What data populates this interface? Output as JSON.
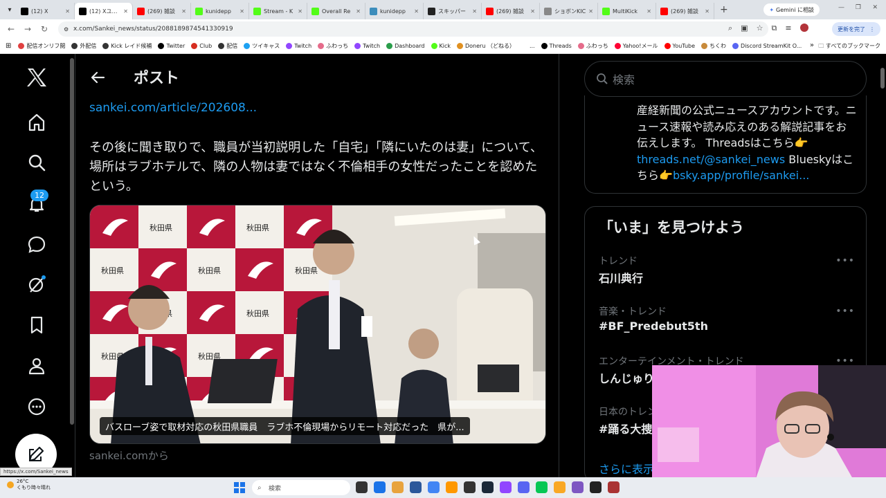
{
  "browser": {
    "tabs": [
      {
        "title": "(12) X",
        "icon": "x-icon",
        "color": "#000000"
      },
      {
        "title": "(12) Xユーザー",
        "icon": "x-icon",
        "color": "#000000",
        "active": true
      },
      {
        "title": "(269) 雑談",
        "icon": "youtube-icon",
        "color": "#ff0000"
      },
      {
        "title": "kunidepp",
        "icon": "kick-icon",
        "color": "#53fc18"
      },
      {
        "title": "Stream - K",
        "icon": "kick-icon",
        "color": "#53fc18"
      },
      {
        "title": "Overall Re",
        "icon": "kick-icon",
        "color": "#53fc18"
      },
      {
        "title": "kunidepp",
        "icon": "globe-icon",
        "color": "#3c8dbc"
      },
      {
        "title": "スキッパー",
        "icon": "app-icon",
        "color": "#222222"
      },
      {
        "title": "(269) 雑談",
        "icon": "youtube-icon",
        "color": "#ff0000"
      },
      {
        "title": "ショボンKIC",
        "icon": "shobon-icon",
        "color": "#888888"
      },
      {
        "title": "MultiKick",
        "icon": "kick-icon",
        "color": "#53fc18"
      },
      {
        "title": "(269) 雑談",
        "icon": "youtube-icon",
        "color": "#ff0000"
      }
    ],
    "new_tab": "+",
    "gemini_label": "Gemini に相談",
    "url": "x.com/Sankei_news/status/2088189874541330919",
    "update_label": "更新を完了",
    "bookmarks": [
      {
        "label": "配信オンリフ閲",
        "color": "#e04040"
      },
      {
        "label": "外配信",
        "color": "#333333"
      },
      {
        "label": "Kick レイド候補",
        "color": "#333333"
      },
      {
        "label": "Twitter",
        "color": "#000000"
      },
      {
        "label": "Club",
        "color": "#d62d20"
      },
      {
        "label": "配信",
        "color": "#333333"
      },
      {
        "label": "ツイキャス",
        "color": "#1da1f2"
      },
      {
        "label": "Twitch",
        "color": "#9146ff"
      },
      {
        "label": "ふわっち",
        "color": "#e56b8a"
      },
      {
        "label": "Twitch",
        "color": "#9146ff"
      },
      {
        "label": "Dashboard",
        "color": "#2a9d4b"
      },
      {
        "label": "Kick",
        "color": "#53fc18"
      },
      {
        "label": "Doneru （どねる）",
        "color": "#e09020"
      },
      {
        "label": "...",
        "color": "#ffffff"
      },
      {
        "label": "Threads",
        "color": "#000000"
      },
      {
        "label": "ふわっち",
        "color": "#e56b8a"
      },
      {
        "label": "Yahoo!メール",
        "color": "#ff0033"
      },
      {
        "label": "YouTube",
        "color": "#ff0000"
      },
      {
        "label": "ちくわ",
        "color": "#c88a3a"
      },
      {
        "label": "Discord StreamKit O...",
        "color": "#5865f2"
      }
    ],
    "bookmarks_more": "»",
    "all_bookmarks": "すべてのブックマーク"
  },
  "x_nav": {
    "notification_count": "12"
  },
  "post": {
    "header": "ポスト",
    "link": "sankei.com/article/202608...",
    "text": "その後に聞き取りで、職員が当初説明した「自宅」「隣にいたのは妻」について、場所はラブホテルで、隣の人物は妻ではなく不倫相手の女性だったことを認めたという。",
    "card_caption": "バスローブ姿で取材対応の秋田県職員　ラブホ不倫現場からリモート対応だった　県が...",
    "card_source": "sankei.comから",
    "backdrop_label": "秋田県"
  },
  "sidebar": {
    "search_placeholder": "検索",
    "bio_text": "産経新聞の公式ニュースアカウントです。ニュース速報や読み応えのある解説記事をお伝えします。 Threadsはこちら👉",
    "bio_link1": "threads.net/@sankei_news",
    "bio_mid": " Blueskyはこちら👉",
    "bio_link2": "bsky.app/profile/sankei...",
    "trends_title": "「いま」を見つけよう",
    "trends": [
      {
        "context": "トレンド",
        "name": "石川典行"
      },
      {
        "context": "音楽・トレンド",
        "name": "#BF_Predebut5th"
      },
      {
        "context": "エンターテインメント・トレンド",
        "name": "しんじゅり"
      },
      {
        "context": "日本のトレンド",
        "name": "#踊る大捜"
      }
    ],
    "more_dots": "•••",
    "show_more": "さらに表示"
  },
  "status_bar": {
    "hover_url": "https://x.com/Sankei_news"
  },
  "taskbar": {
    "temperature": "26°C",
    "weather": "くもり時々晴れ",
    "search_placeholder": "検索",
    "app_colors": [
      "#333333",
      "#1a73e8",
      "#e8a33d",
      "#2b579a",
      "#4285f4",
      "#ff9800",
      "#333333",
      "#1b2838",
      "#9146ff",
      "#5865f2",
      "#06c755",
      "#f9a825",
      "#7e57c2",
      "#222222",
      "#aa3333"
    ]
  }
}
